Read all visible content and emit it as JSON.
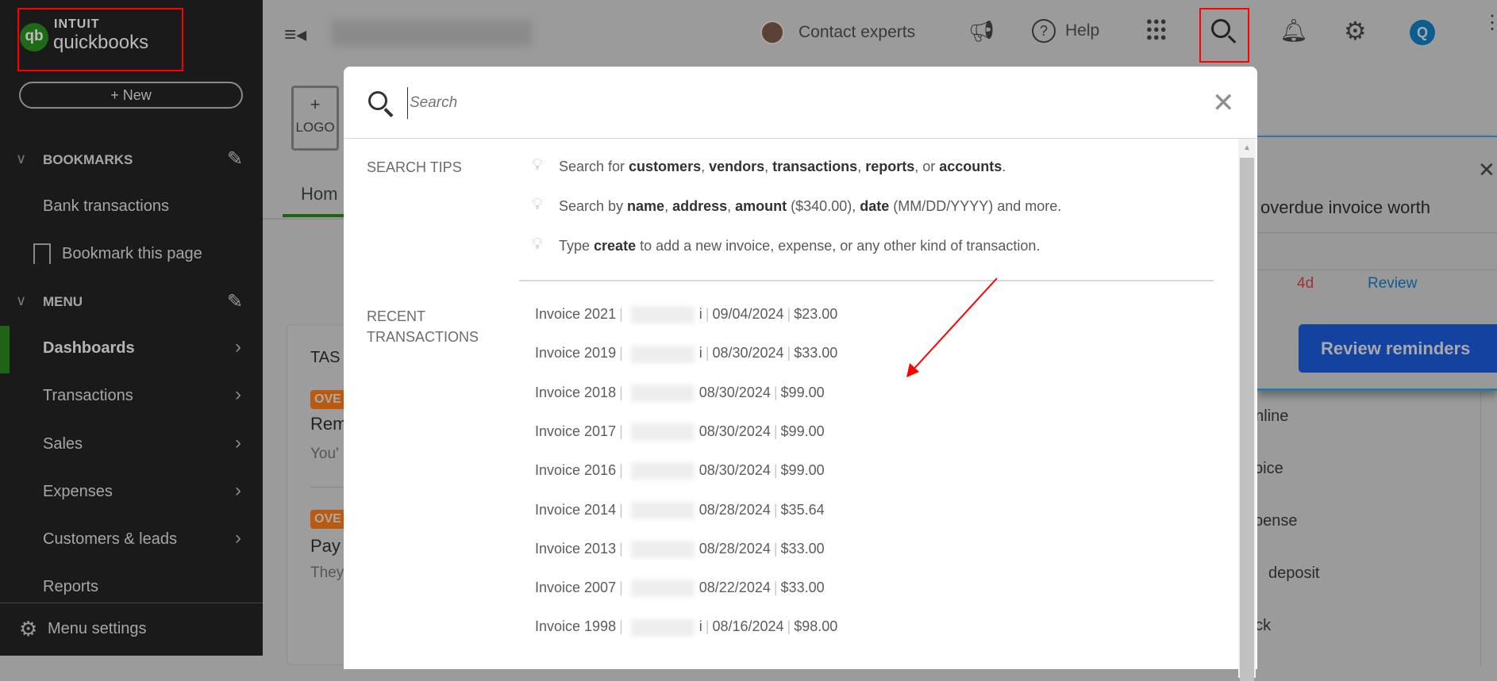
{
  "brand": {
    "line1": "INTUIT",
    "line2": "quickbooks"
  },
  "sidebar": {
    "new_label": "+ New",
    "bookmarks_header": "BOOKMARKS",
    "bookmarks": [
      "Bank transactions",
      "Bookmark this page"
    ],
    "menu_header": "MENU",
    "menu": [
      {
        "label": "Dashboards",
        "active": true
      },
      {
        "label": "Transactions"
      },
      {
        "label": "Sales"
      },
      {
        "label": "Expenses"
      },
      {
        "label": "Customers & leads"
      },
      {
        "label": "Reports"
      }
    ],
    "settings_label": "Menu settings"
  },
  "topbar": {
    "contact": "Contact experts",
    "help": "Help",
    "avatar_letter": "Q"
  },
  "page": {
    "logo_plus": "+",
    "logo_label": "LOGO",
    "tab_home": "Hom",
    "tasks_title": "TAS",
    "badge": "OVE",
    "task1_title": "Rem",
    "task1_sub": "You'",
    "task2_title": "Pay",
    "task2_sub": "They"
  },
  "search": {
    "placeholder": "Search",
    "tips_label": "SEARCH TIPS",
    "tips": [
      [
        {
          "t": "Search for "
        },
        {
          "t": "customers",
          "b": true
        },
        {
          "t": ", "
        },
        {
          "t": "vendors",
          "b": true
        },
        {
          "t": ", "
        },
        {
          "t": "transactions",
          "b": true
        },
        {
          "t": ", "
        },
        {
          "t": "reports",
          "b": true
        },
        {
          "t": ", or "
        },
        {
          "t": "accounts",
          "b": true
        },
        {
          "t": "."
        }
      ],
      [
        {
          "t": "Search by "
        },
        {
          "t": "name",
          "b": true
        },
        {
          "t": ", "
        },
        {
          "t": "address",
          "b": true
        },
        {
          "t": ", "
        },
        {
          "t": "amount",
          "b": true
        },
        {
          "t": " ($340.00), "
        },
        {
          "t": "date",
          "b": true
        },
        {
          "t": " (MM/DD/YYYY) and more."
        }
      ],
      [
        {
          "t": "Type "
        },
        {
          "t": "create",
          "b": true
        },
        {
          "t": " to add a new invoice, expense, or any other kind of transaction."
        }
      ]
    ],
    "recent_label_1": "RECENT",
    "recent_label_2": "TRANSACTIONS",
    "recent": [
      {
        "name": "Invoice 2021",
        "suffix": "i",
        "date": "09/04/2024",
        "amount": "$23.00"
      },
      {
        "name": "Invoice 2019",
        "suffix": "i",
        "date": "08/30/2024",
        "amount": "$33.00"
      },
      {
        "name": "Invoice 2018",
        "suffix": "",
        "date": "08/30/2024",
        "amount": "$99.00"
      },
      {
        "name": "Invoice 2017",
        "suffix": "",
        "date": "08/30/2024",
        "amount": "$99.00"
      },
      {
        "name": "Invoice 2016",
        "suffix": "",
        "date": "08/30/2024",
        "amount": "$99.00"
      },
      {
        "name": "Invoice 2014",
        "suffix": "",
        "date": "08/28/2024",
        "amount": "$35.64"
      },
      {
        "name": "Invoice 2013",
        "suffix": "",
        "date": "08/28/2024",
        "amount": "$33.00"
      },
      {
        "name": "Invoice 2007",
        "suffix": "",
        "date": "08/22/2024",
        "amount": "$33.00"
      },
      {
        "name": "Invoice 1998",
        "suffix": "i",
        "date": "08/16/2024",
        "amount": "$98.00"
      }
    ]
  },
  "reminder": {
    "text": "overdue invoice worth",
    "days": "4d",
    "review": "Review",
    "button": "Review reminders"
  },
  "background_list": [
    "online",
    "voice",
    "xpense",
    "deposit",
    "eck"
  ],
  "colors": {
    "brand_green": "#2ca01c",
    "annotation_red": "#ff0000",
    "primary_blue": "#1442a0",
    "badge_orange": "#b85a10"
  }
}
